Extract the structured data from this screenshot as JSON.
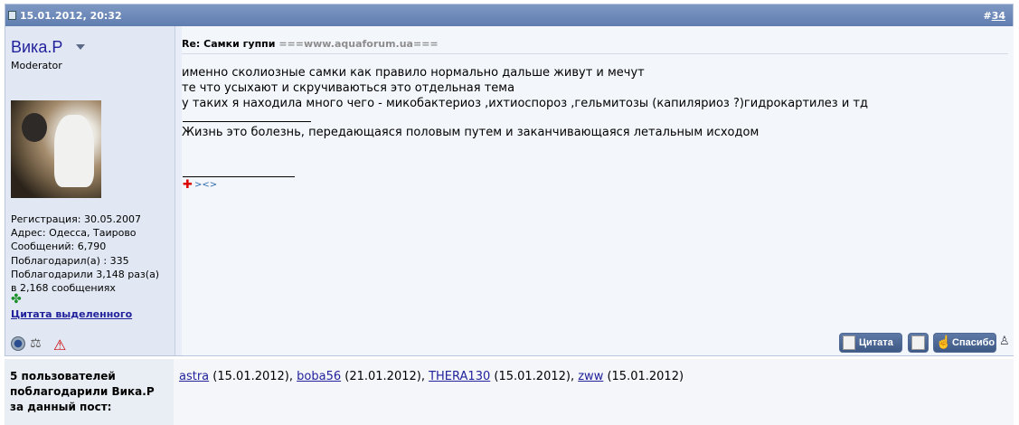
{
  "post": {
    "date": "15.01.2012, 20:32",
    "number_prefix": "#",
    "number": "34"
  },
  "user": {
    "name": "Вика.Р",
    "role": "Moderator",
    "info": [
      "Регистрация: 30.05.2007",
      "Адрес: Одесса, Таирово",
      "Сообщений: 6,790",
      "Поблагодарил(а) : 335",
      "Поблагодарили 3,148 раз(а)",
      "в 2,168 сообщениях"
    ],
    "quote_selected_link": "Цитата выделенного"
  },
  "message": {
    "title": "Re: Самки гуппи",
    "site": "===www.aquaforum.ua===",
    "lines": [
      "именно сколиозные самки как правило нормально дальше живут и мечут",
      "те что усыхают и скручиваються это отдельная тема",
      "у таких я находила много чего - микобактериоз ,ихтиоспороз ,гельмитозы (капиляриоз ?)гидрокартилез и тд"
    ],
    "signature": "Жизнь это болезнь, передающаяся половым путем и заканчивающаяся летальным исходом"
  },
  "buttons": {
    "quote": "Цитата",
    "thanks": "Спасибо"
  },
  "thanks": {
    "label_lines": [
      "5 пользователей",
      "поблагодарили Вика.Р",
      "за данный пост:"
    ],
    "users": [
      {
        "name": "astra",
        "date": "(15.01.2012)",
        "sep": ", "
      },
      {
        "name": "boba56",
        "date": "(21.01.2012)",
        "sep": ", "
      },
      {
        "name": "THERA130",
        "date": "(15.01.2012)",
        "sep": ", "
      },
      {
        "name": "zww",
        "date": "(15.01.2012)",
        "sep": ""
      }
    ]
  },
  "colors": {
    "header_bg": "#6a86b8",
    "username": "#22229c",
    "panel_bg": "#e1e8f3"
  }
}
